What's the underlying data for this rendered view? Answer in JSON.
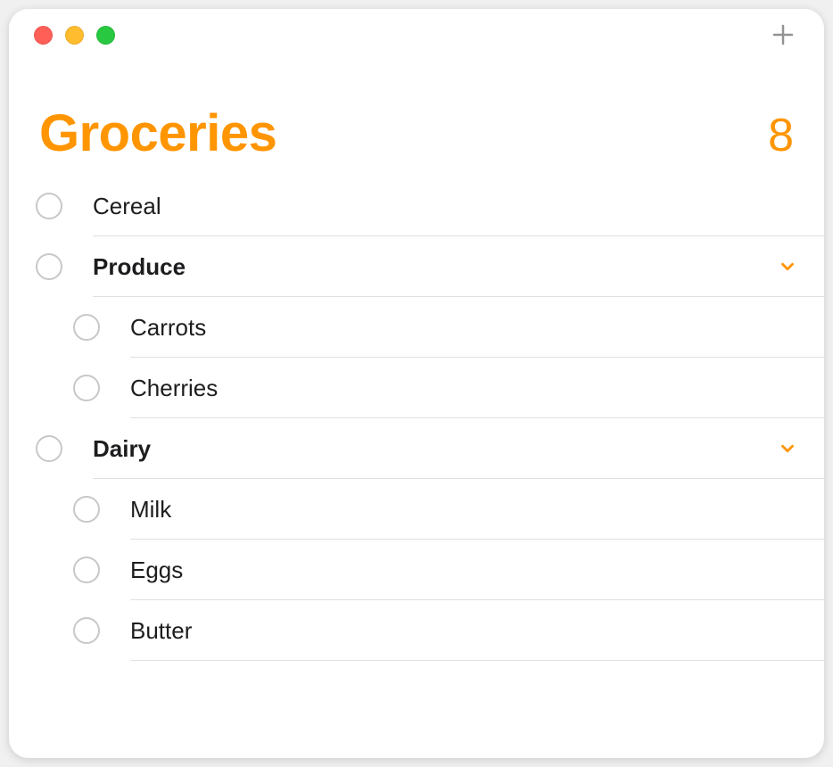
{
  "header": {
    "title": "Groceries",
    "count": "8"
  },
  "items": [
    {
      "label": "Cereal",
      "level": 0,
      "group": false
    },
    {
      "label": "Produce",
      "level": 0,
      "group": true
    },
    {
      "label": "Carrots",
      "level": 1,
      "group": false
    },
    {
      "label": "Cherries",
      "level": 1,
      "group": false
    },
    {
      "label": "Dairy",
      "level": 0,
      "group": true
    },
    {
      "label": "Milk",
      "level": 1,
      "group": false
    },
    {
      "label": "Eggs",
      "level": 1,
      "group": false
    },
    {
      "label": "Butter",
      "level": 1,
      "group": false
    }
  ],
  "colors": {
    "accent": "#ff9500"
  }
}
